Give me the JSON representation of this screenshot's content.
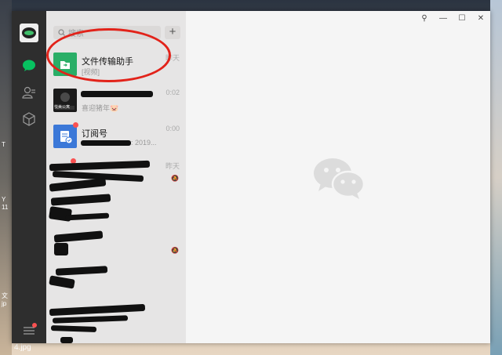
{
  "desktop": {
    "left_fragments": [
      "T",
      "Y",
      "11",
      "文",
      "jp"
    ],
    "bottom_label": "4.jpg"
  },
  "sidebar_nav": {
    "icons": [
      "chat-icon",
      "contacts-icon",
      "box-icon",
      "menu-icon"
    ]
  },
  "search": {
    "placeholder": "搜索",
    "add_label": "+"
  },
  "conversations": [
    {
      "title": "文件传输助手",
      "subtitle": "[视频]",
      "time": "昨天",
      "icon_color": "#2aae67",
      "highlighted": true
    },
    {
      "title": "",
      "subtitle": "喜迎猪年🐷",
      "time": "0:02",
      "icon_label": "悦美公寓",
      "redacted": true
    },
    {
      "title": "订阅号",
      "subtitle": ": 2019...",
      "time": "0:00",
      "icon_color": "#3b78d8",
      "badge": true
    },
    {
      "title": "",
      "subtitle": "",
      "time": "昨天",
      "redacted": true,
      "badge": true,
      "muted": true
    },
    {
      "title": "",
      "subtitle": "",
      "time": "",
      "redacted": true
    },
    {
      "title": "",
      "subtitle": "",
      "time": "",
      "redacted": true,
      "muted": true
    },
    {
      "title": "",
      "subtitle": "",
      "time": "",
      "redacted": true
    },
    {
      "title": "",
      "subtitle": "",
      "time": "",
      "redacted": true
    }
  ],
  "window_controls": {
    "pin": "⚲",
    "minimize": "—",
    "maximize": "☐",
    "close": "✕"
  },
  "colors": {
    "nav_bg": "#2e2e2e",
    "list_bg": "#e6e5e5",
    "main_bg": "#f5f5f5",
    "accent": "#07c160",
    "annotation": "#e2231a"
  }
}
